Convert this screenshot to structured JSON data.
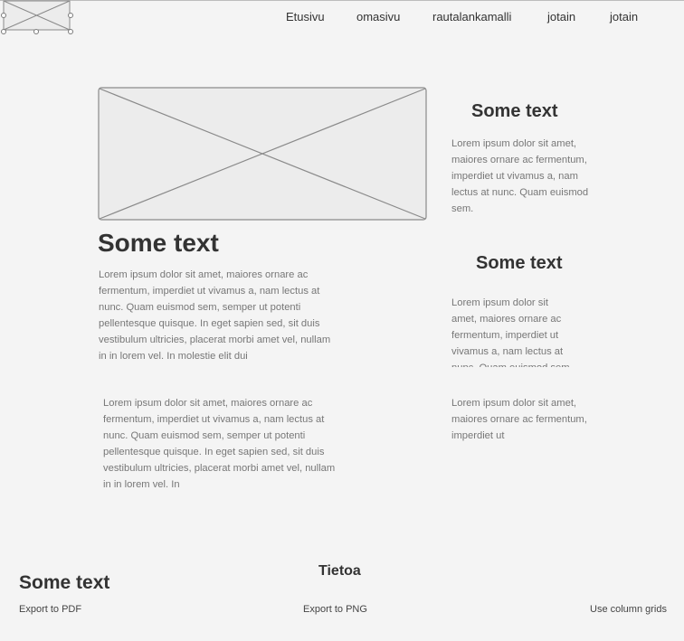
{
  "nav": {
    "items": [
      "Etusivu",
      "omasivu",
      "rautalankamalli",
      "jotain",
      "jotain"
    ]
  },
  "main": {
    "heading": "Some text",
    "paragraph": "Lorem ipsum dolor sit amet, maiores ornare ac fermentum, imperdiet ut vivamus a, nam lectus at nunc. Quam euismod sem, semper ut potenti pellentesque quisque. In eget sapien sed, sit duis vestibulum ultricies, placerat morbi amet vel, nullam in in lorem vel. In molestie elit dui",
    "paragraph2": "Lorem ipsum dolor sit amet, maiores ornare ac fermentum, imperdiet ut vivamus a, nam lectus at nunc. Quam euismod sem, semper ut potenti pellentesque quisque. In eget sapien sed, sit duis vestibulum ultricies, placerat morbi amet vel, nullam in in lorem vel. In"
  },
  "aside": {
    "blocks": [
      {
        "heading": "Some text",
        "text": "Lorem ipsum dolor sit amet, maiores ornare ac fermentum, imperdiet ut vivamus a, nam lectus at nunc. Quam euismod sem."
      },
      {
        "heading": "Some text",
        "text": "Lorem ipsum dolor sit amet, maiores ornare ac fermentum, imperdiet ut vivamus a, nam lectus at nunc. Quam euismod sem."
      }
    ],
    "text3": "Lorem ipsum dolor sit amet, maiores ornare ac fermentum, imperdiet ut"
  },
  "footer": {
    "heading": "Some text",
    "center_heading": "Tietoa",
    "export_pdf": "Export to PDF",
    "export_png": "Export to PNG",
    "column_grids": "Use column grids"
  }
}
